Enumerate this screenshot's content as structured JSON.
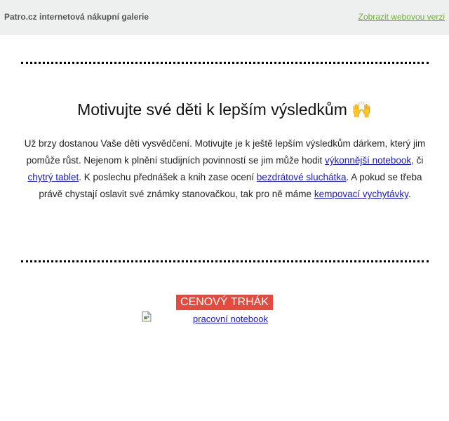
{
  "header": {
    "brand": "Patro.cz internetová nákupní galerie",
    "web_version_link": "Zobrazit webovou verzi"
  },
  "hero": {
    "title": "Motivujte své děti k lepším výsledkům 🙌",
    "paragraph": [
      {
        "text": "Už brzy dostanou Vaše děti vysvědčení. Motivujte je k ještě lepším výsledkům dárkem, který jim pomůže růst. Nejenom k plnění studijních povinností se jim může hodit ",
        "link": false
      },
      {
        "text": "výkonnější notebook",
        "link": true,
        "name": "link-vykonnejsi-notebook"
      },
      {
        "text": ", či ",
        "link": false
      },
      {
        "text": "chytrý tablet",
        "link": true,
        "name": "link-chytry-tablet"
      },
      {
        "text": ". K poslechu přednášek a knih zase ocení ",
        "link": false
      },
      {
        "text": "bezdrátové sluchátka",
        "link": true,
        "name": "link-bezdratove-sluchatka"
      },
      {
        "text": ". A pokud se třeba právě chystají oslavit své známky stanovačkou, tak pro ně máme ",
        "link": false
      },
      {
        "text": "kempovací vychytávky",
        "link": true,
        "name": "link-kempovaci-vychytavky"
      },
      {
        "text": ".",
        "link": false
      }
    ]
  },
  "product": {
    "badge": "CENOVÝ TRHÁK",
    "image_alt": "pracovní notebook",
    "broken_image_icon": "broken-image-icon"
  },
  "colors": {
    "header_bg": "#eef0f0",
    "web_link": "#6fb02e",
    "link": "#1a1ab8",
    "badge_bg": "#e24b3d"
  }
}
